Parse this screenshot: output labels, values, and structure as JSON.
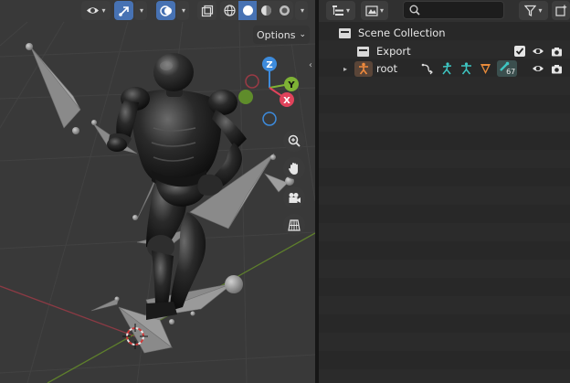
{
  "viewport": {
    "options_label": "Options",
    "gizmo": {
      "z": "Z",
      "y": "Y",
      "x": "X"
    },
    "icons": [
      "view-eye-icon",
      "object-gizmo-icon",
      "overlays-icon",
      "xray-icon",
      "wireframe-shading-icon",
      "solid-shading-icon",
      "material-shading-icon",
      "rendered-shading-icon",
      "zoom-icon",
      "pan-hand-icon",
      "camera-icon",
      "ortho-grid-icon"
    ]
  },
  "outliner": {
    "search": {
      "placeholder": "",
      "value": ""
    },
    "scene_collection": "Scene Collection",
    "rows": [
      {
        "label": "Export"
      },
      {
        "label": "root",
        "badge": "67"
      }
    ]
  },
  "colors": {
    "accent": "#4772b3",
    "axis_x": "#e0435b",
    "axis_y": "#7eb235",
    "axis_z": "#3d8bdc"
  }
}
